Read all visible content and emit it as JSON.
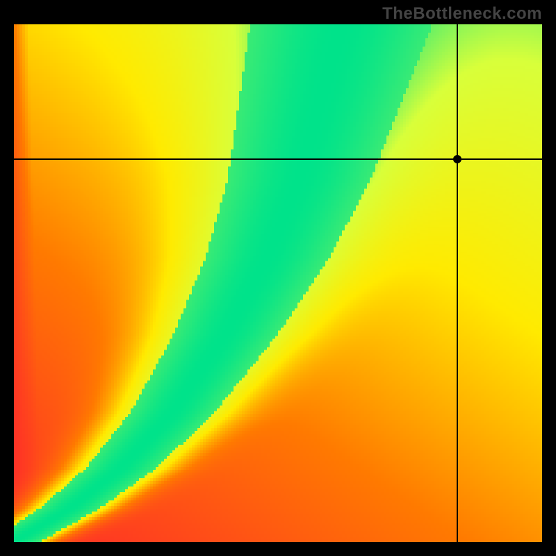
{
  "watermark": "TheBottleneck.com",
  "chart_data": {
    "type": "heatmap",
    "title": "",
    "xlabel": "",
    "ylabel": "",
    "xlim": [
      0,
      100
    ],
    "ylim": [
      0,
      100
    ],
    "colorscale": [
      {
        "stop": 0.0,
        "color": "#ff2a2a"
      },
      {
        "stop": 0.3,
        "color": "#ff7a00"
      },
      {
        "stop": 0.55,
        "color": "#ffea00"
      },
      {
        "stop": 0.82,
        "color": "#d8ff3a"
      },
      {
        "stop": 1.0,
        "color": "#00e38a"
      }
    ],
    "optimal_curve_description": "diagonal ridge from bottom-left toward top-center, curving steeper in the upper half",
    "ridge_sampled_points": [
      {
        "x": 0,
        "y": 0
      },
      {
        "x": 10,
        "y": 6
      },
      {
        "x": 20,
        "y": 14
      },
      {
        "x": 30,
        "y": 25
      },
      {
        "x": 40,
        "y": 40
      },
      {
        "x": 48,
        "y": 55
      },
      {
        "x": 54,
        "y": 70
      },
      {
        "x": 58,
        "y": 85
      },
      {
        "x": 62,
        "y": 100
      }
    ],
    "crosshair": {
      "x": 84,
      "y": 74
    },
    "marker": {
      "x": 84,
      "y": 74
    },
    "grid": false,
    "legend": false
  }
}
